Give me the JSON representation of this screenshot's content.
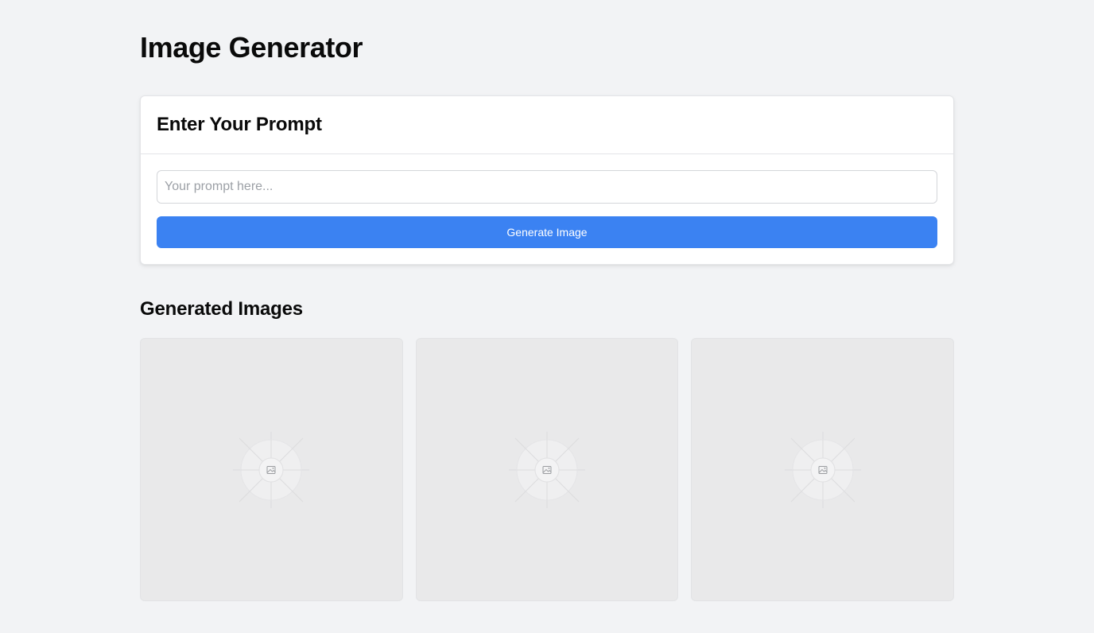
{
  "page": {
    "title": "Image Generator"
  },
  "prompt_card": {
    "title": "Enter Your Prompt",
    "input": {
      "value": "",
      "placeholder": "Your prompt here..."
    },
    "button_label": "Generate Image"
  },
  "gallery": {
    "title": "Generated Images",
    "items": [
      {
        "icon": "image-placeholder-icon"
      },
      {
        "icon": "image-placeholder-icon"
      },
      {
        "icon": "image-placeholder-icon"
      }
    ]
  },
  "colors": {
    "accent": "#3b82f2",
    "background": "#f2f3f5",
    "tile": "#e9e9ea"
  }
}
